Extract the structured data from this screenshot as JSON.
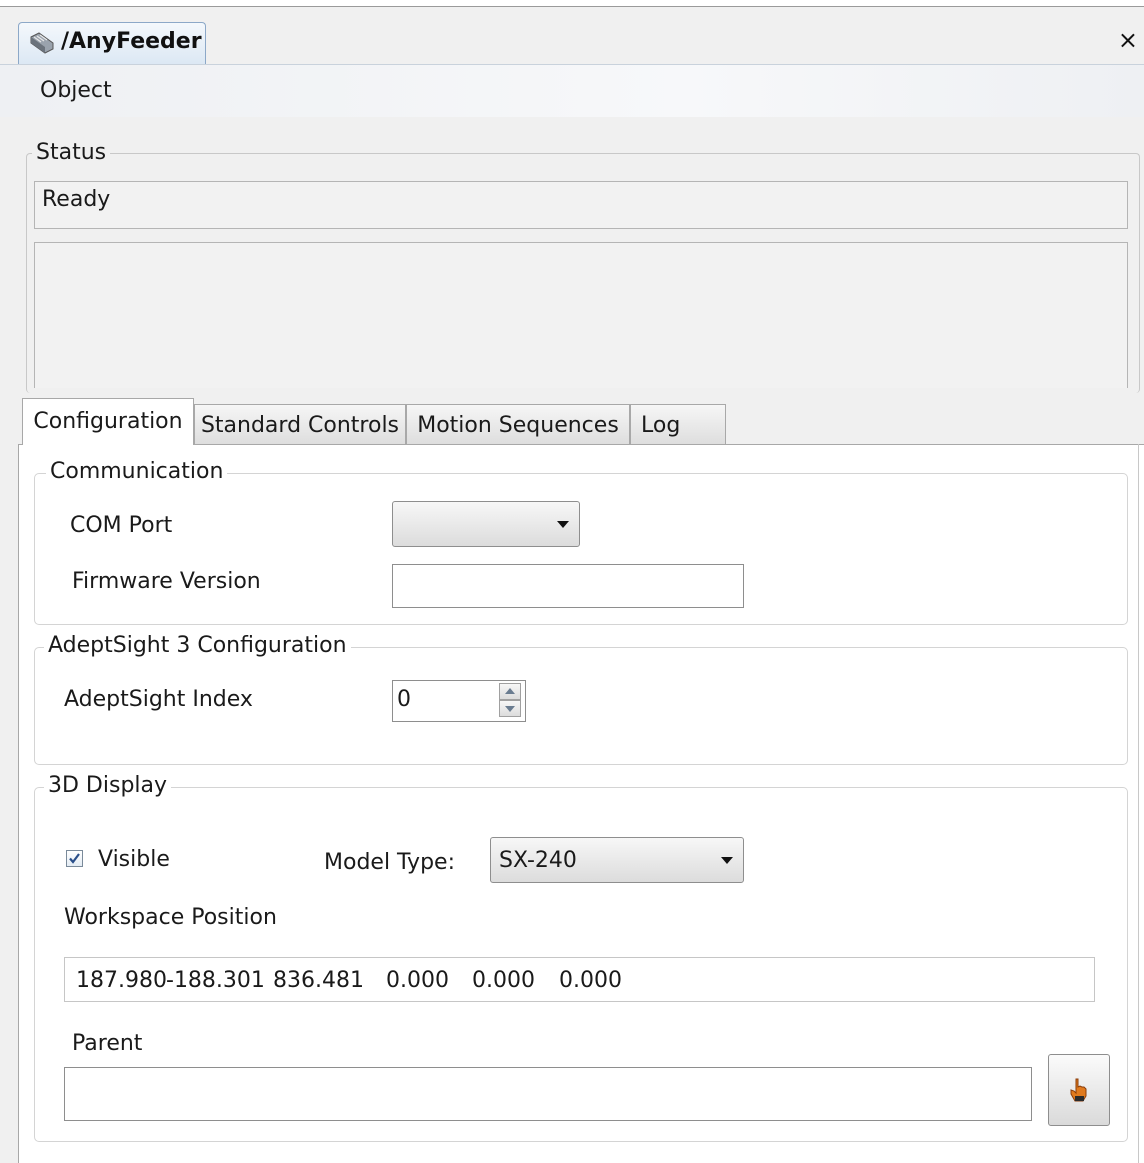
{
  "window": {
    "title": "/AnyFeeder",
    "close_label": "×"
  },
  "menu": {
    "items": [
      "Object"
    ]
  },
  "status": {
    "group_label": "Status",
    "value": "Ready"
  },
  "tabs": [
    {
      "label": "Configuration",
      "active": true
    },
    {
      "label": "Standard Controls",
      "active": false
    },
    {
      "label": "Motion Sequences",
      "active": false
    },
    {
      "label": "Log",
      "active": false
    }
  ],
  "communication": {
    "group_label": "Communication",
    "com_port_label": "COM Port",
    "com_port_value": "",
    "firmware_label": "Firmware Version",
    "firmware_value": ""
  },
  "adeptsight": {
    "group_label": "AdeptSight 3 Configuration",
    "index_label": "AdeptSight Index",
    "index_value": "0"
  },
  "display3d": {
    "group_label": "3D Display",
    "visible_label": "Visible",
    "visible_checked": true,
    "model_type_label": "Model Type:",
    "model_type_value": "SX-240",
    "workspace_label": "Workspace Position",
    "workspace_values": [
      "187.980",
      "-188.301",
      "836.481",
      "0.000",
      "0.000",
      "0.000"
    ],
    "parent_label": "Parent",
    "parent_value": ""
  },
  "icons": {
    "window_icon": "feeder-icon",
    "pick_icon": "hand-pointer-icon"
  },
  "colors": {
    "checkbox_check": "#2a4f8a",
    "hand_icon": "#e07a1e"
  }
}
